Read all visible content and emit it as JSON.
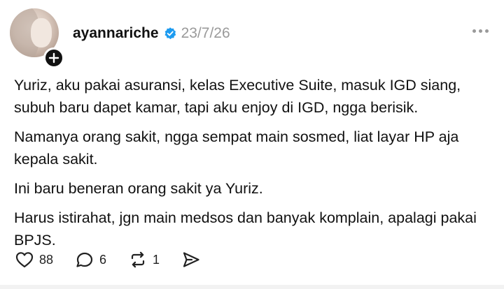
{
  "post": {
    "username": "ayannariche",
    "verified": true,
    "timestamp": "23/7/26",
    "paragraphs": [
      "Yuriz, aku pakai asuransi, kelas Executive Suite, masuk IGD siang, subuh baru dapet kamar, tapi aku enjoy di IGD, ngga berisik.",
      "Namanya orang sakit, ngga sempat main sosmed, liat layar HP aja kepala sakit.",
      "Ini baru beneran orang sakit ya Yuriz.",
      "Harus istirahat, jgn main medsos dan banyak komplain, apalagi pakai BPJS."
    ]
  },
  "actions": {
    "likes": "88",
    "comments": "6",
    "reposts": "1"
  },
  "colors": {
    "verified_badge": "#1d9bf0",
    "timestamp": "#9a9a9a",
    "text": "#111111"
  },
  "icons": [
    "plus-icon",
    "verified-icon",
    "more-icon",
    "heart-icon",
    "comment-icon",
    "repost-icon",
    "share-icon"
  ]
}
